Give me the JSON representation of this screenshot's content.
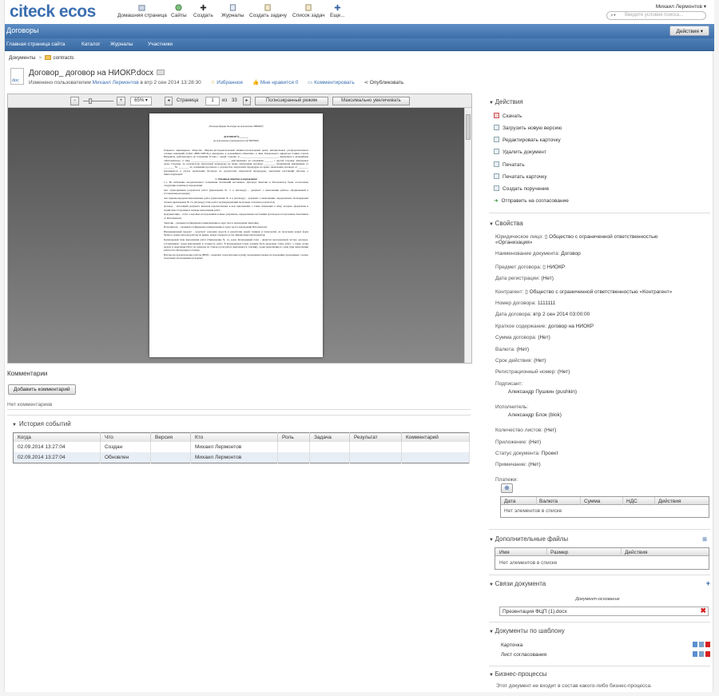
{
  "header": {
    "logo_main": "citeck",
    "logo_sub": "ecos",
    "nav": [
      "Домашняя страница",
      "Сайты",
      "Создать",
      "Журналы",
      "Создать задачу",
      "Список задач",
      "Еще..."
    ],
    "user": "Михаил Лермонтов",
    "search_placeholder": "Введите условия поиска..."
  },
  "site": {
    "title": "Договоры",
    "actions_label": "Действия",
    "subnav": [
      "Главная страница сайта",
      "Каталог",
      "Журналы",
      "Участники"
    ]
  },
  "breadcrumb": [
    "Документы",
    "contracts"
  ],
  "document": {
    "icon_tag": "doc",
    "title": "Договор_ договор на НИОКР.docx",
    "modified_prefix": "Изменено пользователем",
    "modified_user": "Михаил Лермонтов",
    "modified_date": "в втр 2 сен 2014 13:28:30",
    "favorites": "Избранное",
    "likes": "Мне нравится",
    "likes_count": "0",
    "comment": "Комментировать",
    "share": "Опубликовать"
  },
  "viewer": {
    "zoom": "65%",
    "page_label": "Страница",
    "page": "1",
    "of": "из",
    "pages": "33",
    "fullscreen": "Полноэкранный режим",
    "maximize": "Максимально увеличивать",
    "doc_header": "(Типовая форма договора на выполнение НИОКР)",
    "doc_title": "ДОГОВОР №_______",
    "doc_subtitle": "на выполнение (указывается вид НИОКР)",
    "doc_text": [
      "Открытое акционерное общество «Научно-исследовательский машиностроительный центр материальных распределительных сетевых компаний» (ОАО «НИЦ МРСК»), именуемое в дальнейшем «Заказчик», в лице Генерального директора Санина Сергея Юрьевича, действующего на основании Устава, с одной стороны, и ______________________________, именуемое в дальнейшем «Исполнитель», в лице ______________________________, действующего на основании ______, с другой стороны, именуемые далее Стороны, по результатам закупочной процедуры на право заключения договора ________, объявленной извещением от ________ № ________ на основании протокола о результатах закупочной процедуры на право заключения договора от ________ (указывается в случае заключения Договора по результатам закупочной процедуры), заключили настоящий Договор о нижеследующем:",
      "1. Основные понятия и определения",
      "1.1. Во избежание неоднозначного толкования положений настоящего Договора Заказчик и Исполнитель были согласованы следующие понятия и определения:",
      "Акт сдачи-приемки результатов работ (приложение № 5 к Договору) – документ о выполнении работы, оформленный в установленном порядке;",
      "Акт приема-передачи выполненных работ (приложение № 4 к Договору) – документ о выполнении, определенного Календарным планом (приложение № 2 к Договору) этапа работ подтверждающий получение отчетных результатов;",
      "Договор – настоящий документ, включая перечисленные в нем приложения, а также изменения к нему, которые оформлены и подписаны Сторонами в порядке выполнения работ;",
      "Документация – отчет о научных исследованиях и иные документы, определенные настоящим Договором и получаемые Заказчиком от Исполнителя;",
      "Заказчик – указывается фирменное наименование и адрес места нахождения Заказчика;",
      "Исполнитель – указывается фирменное наименование и адрес места нахождения Исполнителя;",
      "Инновационный продукт – результат освоения средств и разработки новой техники и технологий, на получение новых форм бизнеса, новых методов работы на рынке, новых товаров и услуг, финансовых инструментов;",
      "Календарный план выполнения работ (Приложение № 2), далее Календарный план – является неотъемлемой частью договора, устанавливает сроки выполнения и стоимость работ. В Календарном плане должны быть выделены этапы работ, а также сроки начала и окончания Работ по каждому из этапов (если работа выполняется этапами), сроки выполнения и сдачи (при выполнении работы без Календарного плана);",
      "Научно-исследовательские работы (НИР) – комплекс теоретических и (или) экспериментальных исследований, проводимых с целью получения обоснованных исходных"
    ]
  },
  "comments": {
    "title": "Комментарии",
    "add": "Добавить комментарий",
    "empty": "Нет комментариев"
  },
  "history": {
    "title": "История событий",
    "columns": [
      "Когда",
      "Что",
      "Версия",
      "Кто",
      "Роль",
      "Задача",
      "Результат",
      "Комментарий"
    ],
    "rows": [
      [
        "02.09.2014 13:27:04",
        "Создан",
        "",
        "Михаил Лермонтов",
        "",
        "",
        "",
        ""
      ],
      [
        "02.09.2014 13:27:04",
        "Обновлен",
        "",
        "Михаил Лермонтов",
        "",
        "",
        "",
        ""
      ]
    ]
  },
  "actions": {
    "title": "Действия",
    "items": [
      "Скачать",
      "Загрузить новую версию",
      "Редактировать карточку",
      "Удалить документ",
      "Печатать",
      "Печатать карточку",
      "Создать поручение",
      "Отправить на согласование"
    ]
  },
  "properties": {
    "title": "Свойства",
    "legal_entity_label": "Юридическое лицо:",
    "legal_entity_1": "Общество с ограниченной ответственностью",
    "legal_entity_2": "«Организация»",
    "doc_name_label": "Наименование документа:",
    "doc_name": "Договор",
    "subject_label": "Предмет договора:",
    "subject": "НИОКР",
    "reg_date_label": "Дата регистрации:",
    "reg_date": "(Нет)",
    "contractor_label": "Контрагент:",
    "contractor": "Общество с ограниченной ответственностью «Контрагент»",
    "number_label": "Номер договора:",
    "number": "1111111",
    "date_label": "Дата договора:",
    "date": "втр 2 сен 2014 03:00:00",
    "summary_label": "Краткое содержание:",
    "summary": "договор на НИОКР",
    "sum_label": "Сумма договора:",
    "sum": "(Нет)",
    "currency_label": "Валюта:",
    "currency": "(Нет)",
    "term_label": "Срок действия:",
    "term": "(Нет)",
    "regnum_label": "Регистрационный номер:",
    "regnum": "(Нет)",
    "signer_label": "Подписант:",
    "signer": "Александр Пушкин (pushkin)",
    "executor_label": "Исполнитель:",
    "executor": "Александр Блок (blok)",
    "sheets_label": "Количество листов:",
    "sheets": "(Нет)",
    "attachment_label": "Приложение:",
    "attachment": "(Нет)",
    "status_label": "Статус документа:",
    "status": "Проект",
    "note_label": "Примечание:",
    "note": "(Нет)",
    "payments_label": "Платежи:",
    "payments_columns": [
      "Дата",
      "Валюта",
      "Сумма",
      "НДС",
      "Действия"
    ],
    "payments_empty": "Нет элементов в списке"
  },
  "extra_files": {
    "title": "Дополнительные файлы",
    "columns": [
      "Имя",
      "Размер",
      "Действия"
    ],
    "empty": "Нет элементов в списке"
  },
  "links": {
    "title": "Связи документа",
    "basis_label": "Документ-основание",
    "basis_value": "Презентация ФЦП (1).docx"
  },
  "templates": {
    "title": "Документы по шаблону",
    "items": [
      "Карточка",
      "Лист согласования"
    ]
  },
  "bp": {
    "title": "Бизнес-процессы",
    "text": "Этот документ не входит в состав какого-либо бизнес-процесса."
  },
  "colors": {
    "accent": "#3b6fb0",
    "title_bar": "#4f7fb6",
    "history_alt_row": "#e8eef6",
    "delete_red": "#d42020"
  }
}
